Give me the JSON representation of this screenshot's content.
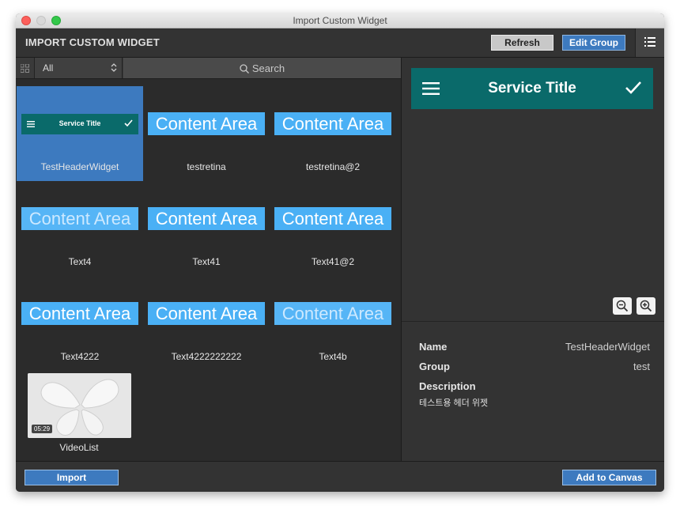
{
  "window": {
    "title": "Import Custom Widget"
  },
  "header": {
    "title": "IMPORT CUSTOM WIDGET",
    "refresh_label": "Refresh",
    "edit_group_label": "Edit Group",
    "menu_icon": "list-icon"
  },
  "filter": {
    "selected": "All",
    "search_placeholder": "Search"
  },
  "widgets": [
    {
      "label": "TestHeaderWidget",
      "thumb_type": "header",
      "thumb_text": "Service Title",
      "selected": true
    },
    {
      "label": "testretina",
      "thumb_type": "content",
      "thumb_text": "Content Area"
    },
    {
      "label": "testretina@2",
      "thumb_type": "content",
      "thumb_text": "Content Area"
    },
    {
      "label": "Text4",
      "thumb_type": "content",
      "thumb_text": "Content Area",
      "faded": true
    },
    {
      "label": "Text41",
      "thumb_type": "content",
      "thumb_text": "Content Area"
    },
    {
      "label": "Text41@2",
      "thumb_type": "content",
      "thumb_text": "Content Area"
    },
    {
      "label": "Text4222",
      "thumb_type": "content",
      "thumb_text": "Content Area"
    },
    {
      "label": "Text4222222222",
      "thumb_type": "content",
      "thumb_text": "Content Area"
    },
    {
      "label": "Text4b",
      "thumb_type": "content",
      "thumb_text": "Content Area",
      "faded": true
    },
    {
      "label": "VideoList",
      "thumb_type": "video",
      "duration": "05:29"
    }
  ],
  "preview": {
    "title": "Service Title",
    "accent": "#0a6a6a"
  },
  "details": {
    "name_label": "Name",
    "name_value": "TestHeaderWidget",
    "group_label": "Group",
    "group_value": "test",
    "description_label": "Description",
    "description_value": "테스트용 헤더 위젯"
  },
  "footer": {
    "import_label": "Import",
    "add_label": "Add to Canvas"
  },
  "colors": {
    "accent_blue": "#3d7abf",
    "content_blue": "#4ab0f5",
    "teal": "#0a6a6a"
  }
}
